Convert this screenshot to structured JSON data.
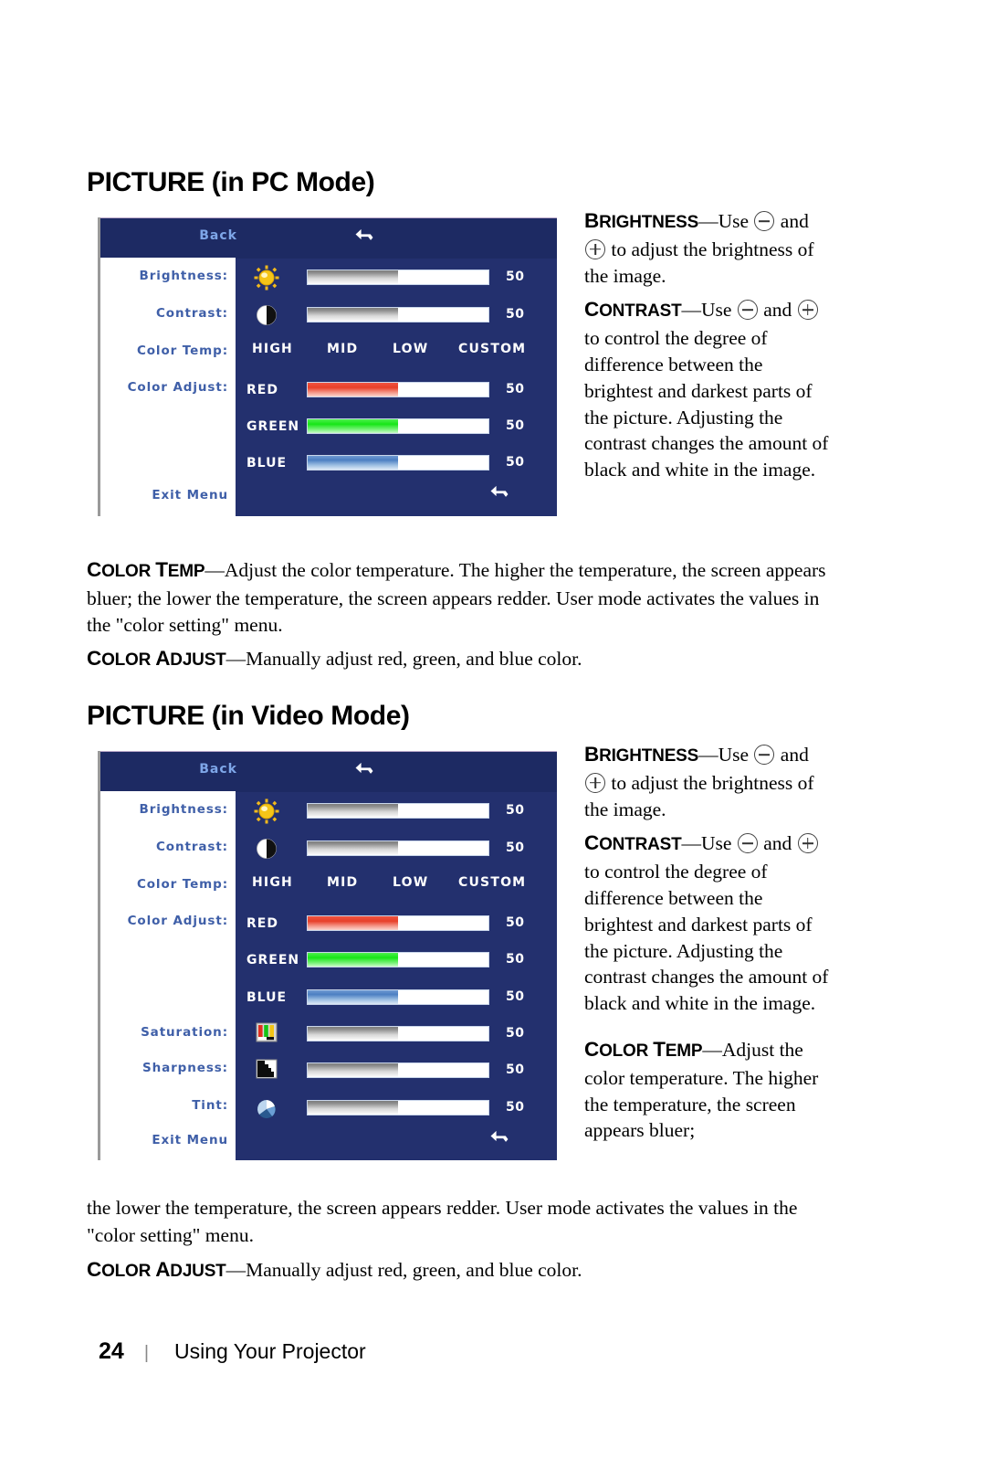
{
  "page": {
    "footer_page_number": "24",
    "footer_separator": "|",
    "footer_title": "Using Your Projector"
  },
  "sections": [
    {
      "heading": "PICTURE (in PC Mode)",
      "osd": {
        "back_label": "Back",
        "return_icon": "return-arrow-icon",
        "exit_label": "Exit Menu",
        "rows": [
          {
            "label": "Brightness:",
            "icon": "sun-icon",
            "value": "50",
            "fill": "grey"
          },
          {
            "label": "Contrast:",
            "icon": "contrast-icon",
            "value": "50",
            "fill": "grey"
          }
        ],
        "color_temp": {
          "label": "Color Temp:",
          "options": [
            "HIGH",
            "MID",
            "LOW",
            "CUSTOM"
          ]
        },
        "color_adjust": {
          "label": "Color Adjust:",
          "channels": [
            {
              "name": "RED",
              "value": "50",
              "fill": "red"
            },
            {
              "name": "GREEN",
              "value": "50",
              "fill": "green"
            },
            {
              "name": "BLUE",
              "value": "50",
              "fill": "blue"
            }
          ]
        }
      },
      "side_paragraphs": {
        "brightness_term": "BRIGHTNESS",
        "brightness_text_a": "Use ",
        "brightness_text_b": " and ",
        "brightness_text_c": " to adjust the brightness of the image.",
        "contrast_term": "CONTRAST",
        "contrast_text_a": "Use ",
        "contrast_text_b": " and ",
        "contrast_text_c": " to control the degree of difference between the brightest and darkest parts of the picture. Adjusting the contrast changes the amount of black and white in the image."
      },
      "flow_paragraphs": [
        {
          "term": "COLOR TEMP",
          "body": "Adjust the color temperature. The higher the temperature, the screen appears bluer; the lower the temperature, the screen appears redder. User mode activates the values in the \"color setting\" menu."
        },
        {
          "term": "COLOR ADJUST",
          "body": "Manually adjust red, green, and blue color."
        }
      ]
    },
    {
      "heading": "PICTURE (in Video Mode)",
      "osd": {
        "back_label": "Back",
        "return_icon": "return-arrow-icon",
        "exit_label": "Exit Menu",
        "rows": [
          {
            "label": "Brightness:",
            "icon": "sun-icon",
            "value": "50",
            "fill": "grey"
          },
          {
            "label": "Contrast:",
            "icon": "contrast-icon",
            "value": "50",
            "fill": "grey"
          }
        ],
        "color_temp": {
          "label": "Color Temp:",
          "options": [
            "HIGH",
            "MID",
            "LOW",
            "CUSTOM"
          ]
        },
        "color_adjust": {
          "label": "Color Adjust:",
          "channels": [
            {
              "name": "RED",
              "value": "50",
              "fill": "red"
            },
            {
              "name": "GREEN",
              "value": "50",
              "fill": "green"
            },
            {
              "name": "BLUE",
              "value": "50",
              "fill": "blue"
            }
          ]
        },
        "extra_rows": [
          {
            "label": "Saturation:",
            "icon": "color-bars-icon",
            "value": "50",
            "fill": "grey"
          },
          {
            "label": "Sharpness:",
            "icon": "sharpness-icon",
            "value": "50",
            "fill": "grey"
          },
          {
            "label": "Tint:",
            "icon": "tint-color-wheel-icon",
            "value": "50",
            "fill": "grey"
          }
        ]
      },
      "side_paragraphs": {
        "brightness_term": "BRIGHTNESS",
        "brightness_text_a": "Use ",
        "brightness_text_b": " and ",
        "brightness_text_c": " to adjust the brightness of the image.",
        "contrast_term": "CONTRAST",
        "contrast_text_a": "Use ",
        "contrast_text_b": " and ",
        "contrast_text_c": " to control the degree of difference between the brightest and darkest parts of the picture. Adjusting the contrast changes the amount of black and white in the image.",
        "colortemp_term": "COLOR TEMP",
        "colortemp_text": "Adjust the color temperature. The higher the temperature, the screen appears bluer;"
      },
      "flow_paragraphs": [
        {
          "term": "",
          "body": "the lower the temperature, the screen appears redder. User mode activates the values in the \"color setting\" menu."
        },
        {
          "term": "COLOR ADJUST",
          "body": "Manually adjust red, green, and blue color."
        }
      ]
    }
  ],
  "colors": {
    "osd_panel": "#23306e",
    "osd_header": "#1d2a63",
    "label_text": "#3f5fa8",
    "back_text": "#7ea6e8"
  }
}
